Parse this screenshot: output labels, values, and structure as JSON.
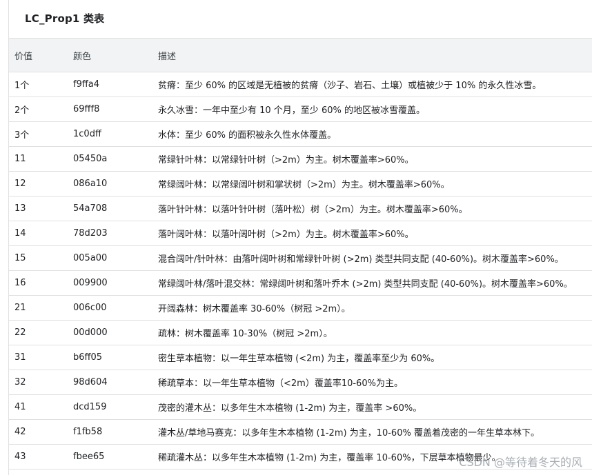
{
  "title": "LC_Prop1 类表",
  "headers": [
    "价值",
    "颜色",
    "描述"
  ],
  "rows": [
    {
      "value": "1个",
      "color": "f9ffa4",
      "desc": "贫瘠：至少 60% 的区域是无植被的贫瘠（沙子、岩石、土壤）或植被少于 10% 的永久性冰雪。"
    },
    {
      "value": "2个",
      "color": "69fff8",
      "desc": "永久冰雪：一年中至少有 10 个月，至少 60% 的地区被冰雪覆盖。"
    },
    {
      "value": "3个",
      "color": "1c0dff",
      "desc": "水体：至少 60% 的面积被永久性水体覆盖。"
    },
    {
      "value": "11",
      "color": "05450a",
      "desc": "常绿针叶林：以常绿针叶树（>2m）为主。树木覆盖率>60%。"
    },
    {
      "value": "12",
      "color": "086a10",
      "desc": "常绿阔叶林：以常绿阔叶树和掌状树（>2m）为主。树木覆盖率>60%。"
    },
    {
      "value": "13",
      "color": "54a708",
      "desc": "落叶针叶林：以落叶针叶树（落叶松）树（>2m）为主。树木覆盖率>60%。"
    },
    {
      "value": "14",
      "color": "78d203",
      "desc": "落叶阔叶林：以落叶阔叶树（>2m）为主。树木覆盖率>60%。"
    },
    {
      "value": "15",
      "color": "005a00",
      "desc": "混合阔叶/针叶林：由落叶阔叶树和常绿针叶树 (>2m) 类型共同支配 (40-60%)。树木覆盖率>60%。"
    },
    {
      "value": "16",
      "color": "009900",
      "desc": "常绿阔叶林/落叶混交林：常绿阔叶树和落叶乔木 (>2m) 类型共同支配 (40-60%)。树木覆盖率>60%。"
    },
    {
      "value": "21",
      "color": "006c00",
      "desc": "开阔森林：树木覆盖率 30-60%（树冠 >2m）。"
    },
    {
      "value": "22",
      "color": "00d000",
      "desc": "疏林：树木覆盖率 10-30%（树冠 >2m）。"
    },
    {
      "value": "31",
      "color": "b6ff05",
      "desc": "密生草本植物：以一年生草本植物 (<2m) 为主，覆盖率至少为 60%。"
    },
    {
      "value": "32",
      "color": "98d604",
      "desc": "稀疏草本：以一年生草本植物（<2m）覆盖率10-60%为主。"
    },
    {
      "value": "41",
      "color": "dcd159",
      "desc": "茂密的灌木丛：以多年生木本植物 (1-2m) 为主，覆盖率 >60%。"
    },
    {
      "value": "42",
      "color": "f1fb58",
      "desc": "灌木丛/草地马赛克：以多年生木本植物 (1-2m) 为主，10-60% 覆盖着茂密的一年生草本林下。"
    },
    {
      "value": "43",
      "color": "fbee65",
      "desc": "稀疏灌木丛：以多年生木本植物 (1-2m) 为主，覆盖率 10-60%，下层草本植物最少。"
    }
  ],
  "watermark": "CSDN @等待着冬天的风"
}
